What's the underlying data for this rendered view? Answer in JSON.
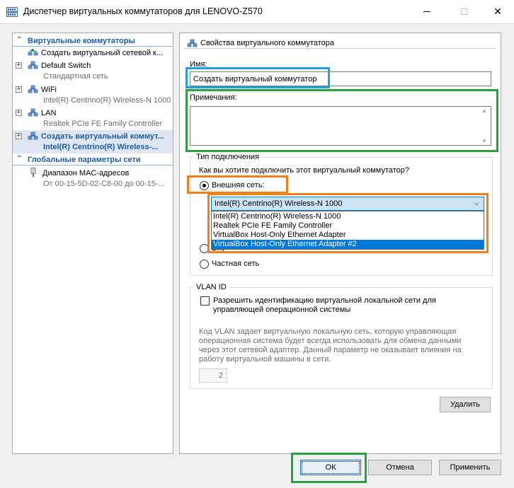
{
  "window": {
    "title": "Диспетчер виртуальных коммутаторов для LENOVO-Z570"
  },
  "tree": {
    "section_switches": "Виртуальные коммутаторы",
    "items": [
      {
        "main": "Создать виртуальный сетевой к..."
      },
      {
        "main": "Default Switch",
        "sub": "Стандартная сеть"
      },
      {
        "main": "WiFi",
        "sub": "Intel(R) Centrino(R) Wireless-N 1000"
      },
      {
        "main": "LAN",
        "sub": "Realtek PCIe FE Family Controller"
      },
      {
        "main": "Создать виртуальный коммут...",
        "sub": "Intel(R) Centrino(R) Wireless-..."
      }
    ],
    "section_global": "Глобальные параметры сети",
    "global_items": [
      {
        "main": "Диапазон MAC-адресов",
        "sub": "От 00-15-5D-02-C8-00 до 00-15-..."
      }
    ]
  },
  "props": {
    "title": "Свойства виртуального коммутатора",
    "name_label": "Имя:",
    "name_value": "Создать виртуальный коммутатор",
    "notes_label": "Примечания:",
    "notes_value": "",
    "conn_group": "Тип подключения",
    "conn_question": "Как вы хотите подключить этот виртуальный коммутатор?",
    "external_label": "Внешняя сеть:",
    "internal_label_partial": "Вну",
    "private_label": "Частная сеть",
    "adapter_selected": "Intel(R) Centrino(R) Wireless-N 1000",
    "adapter_options": [
      "Intel(R) Centrino(R) Wireless-N 1000",
      "Realtek PCIe FE Family Controller",
      "VirtualBox Host-Only Ethernet Adapter",
      "VirtualBox Host-Only Ethernet Adapter #2"
    ],
    "vlan_group": "VLAN ID",
    "vlan_checkbox_line1": "Разрешить идентификацию виртуальной локальной сети для",
    "vlan_checkbox_line2": "управляющей операционной системы",
    "vlan_hint_lines": [
      "Код VLAN задает виртуальную локальную сеть, которую управляющая",
      "операционная система будет всегда использовать для обмена данными",
      "через этот сетевой адаптер. Данный параметр не оказывает влияния на",
      "работу виртуальной машины в сети."
    ],
    "vlan_value": "2",
    "delete_label": "Удалить"
  },
  "footer": {
    "ok_label": "ОК",
    "cancel_label": "Отмена",
    "apply_label": "Применить"
  },
  "colors": {
    "accent": "#1e5ca8",
    "selection": "#0078d7",
    "annotation_blue": "#1ea1dc",
    "annotation_green": "#2ca040",
    "annotation_orange": "#ef7f1a"
  }
}
